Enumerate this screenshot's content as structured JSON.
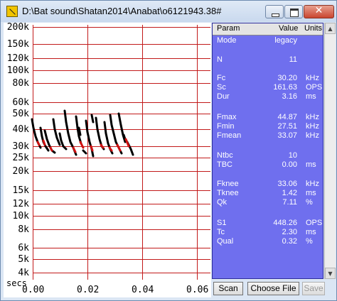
{
  "window": {
    "title": "D:\\Bat sound\\Shatan2014\\Anabat\\o6121943.38#"
  },
  "plot": {
    "y_labels": [
      "200k",
      "150k",
      "120k",
      "100k",
      "80k",
      "60k",
      "50k",
      "40k",
      "30k",
      "25k",
      "20k",
      "15k",
      "12k",
      "10k",
      "8k",
      "6k",
      "5k",
      "4k"
    ],
    "x_labels": [
      "0.00",
      "0.02",
      "0.04",
      "0.06"
    ],
    "x_unit": "secs"
  },
  "params": {
    "headers": {
      "param": "Param",
      "value": "Value",
      "units": "Units"
    },
    "rows": [
      {
        "name": "Mode",
        "value": "legacy",
        "unit": ""
      },
      {
        "name": "N",
        "value": "11",
        "unit": ""
      },
      {
        "name": "Fc",
        "value": "30.20",
        "unit": "kHz"
      },
      {
        "name": "Sc",
        "value": "161.63",
        "unit": "OPS"
      },
      {
        "name": "Dur",
        "value": "3.16",
        "unit": "ms"
      },
      {
        "name": "Fmax",
        "value": "44.87",
        "unit": "kHz"
      },
      {
        "name": "Fmin",
        "value": "27.51",
        "unit": "kHz"
      },
      {
        "name": "Fmean",
        "value": "33.07",
        "unit": "kHz"
      },
      {
        "name": "Ntbc",
        "value": "10",
        "unit": ""
      },
      {
        "name": "TBC",
        "value": "0.00",
        "unit": "ms"
      },
      {
        "name": "Fknee",
        "value": "33.06",
        "unit": "kHz"
      },
      {
        "name": "Tknee",
        "value": "1.42",
        "unit": "ms"
      },
      {
        "name": "Qk",
        "value": "7.11",
        "unit": "%"
      },
      {
        "name": "S1",
        "value": "448.26",
        "unit": "OPS"
      },
      {
        "name": "Tc",
        "value": "2.30",
        "unit": "ms"
      },
      {
        "name": "Qual",
        "value": "0.32",
        "unit": "%"
      }
    ]
  },
  "buttons": {
    "scan": "Scan",
    "choose_file": "Choose File",
    "save": "Save"
  },
  "colors": {
    "grid": "#c21a1a",
    "panel_bg": "#6f6fee",
    "call_trace": "#000000",
    "call_body_highlight": "#d01010"
  }
}
